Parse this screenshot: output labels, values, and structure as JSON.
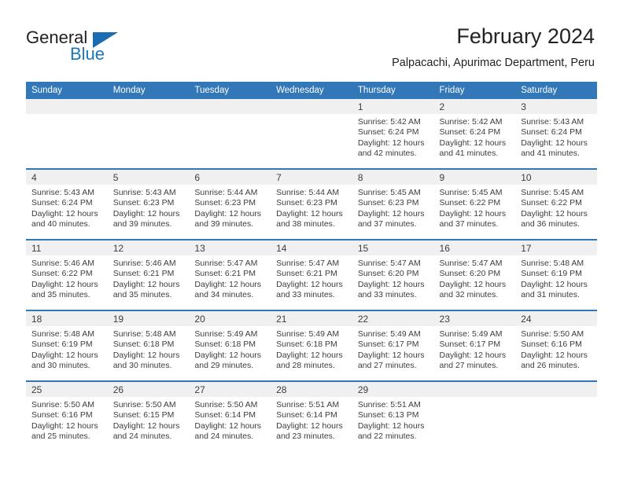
{
  "logo": {
    "word1": "General",
    "word2": "Blue",
    "accent_color": "#1b75bb",
    "triangle_color": "#1b6cb0"
  },
  "header": {
    "title": "February 2024",
    "subtitle": "Palpacachi, Apurimac Department, Peru"
  },
  "theme": {
    "header_blue": "#3277b8",
    "daynum_band": "#f0f0f0",
    "text": "#3d3d3d"
  },
  "calendar": {
    "weekday_headers": [
      "Sunday",
      "Monday",
      "Tuesday",
      "Wednesday",
      "Thursday",
      "Friday",
      "Saturday"
    ],
    "weeks": [
      [
        {
          "day": "",
          "lines": []
        },
        {
          "day": "",
          "lines": []
        },
        {
          "day": "",
          "lines": []
        },
        {
          "day": "",
          "lines": []
        },
        {
          "day": "1",
          "lines": [
            "Sunrise: 5:42 AM",
            "Sunset: 6:24 PM",
            "Daylight: 12 hours",
            "and 42 minutes."
          ]
        },
        {
          "day": "2",
          "lines": [
            "Sunrise: 5:42 AM",
            "Sunset: 6:24 PM",
            "Daylight: 12 hours",
            "and 41 minutes."
          ]
        },
        {
          "day": "3",
          "lines": [
            "Sunrise: 5:43 AM",
            "Sunset: 6:24 PM",
            "Daylight: 12 hours",
            "and 41 minutes."
          ]
        }
      ],
      [
        {
          "day": "4",
          "lines": [
            "Sunrise: 5:43 AM",
            "Sunset: 6:24 PM",
            "Daylight: 12 hours",
            "and 40 minutes."
          ]
        },
        {
          "day": "5",
          "lines": [
            "Sunrise: 5:43 AM",
            "Sunset: 6:23 PM",
            "Daylight: 12 hours",
            "and 39 minutes."
          ]
        },
        {
          "day": "6",
          "lines": [
            "Sunrise: 5:44 AM",
            "Sunset: 6:23 PM",
            "Daylight: 12 hours",
            "and 39 minutes."
          ]
        },
        {
          "day": "7",
          "lines": [
            "Sunrise: 5:44 AM",
            "Sunset: 6:23 PM",
            "Daylight: 12 hours",
            "and 38 minutes."
          ]
        },
        {
          "day": "8",
          "lines": [
            "Sunrise: 5:45 AM",
            "Sunset: 6:23 PM",
            "Daylight: 12 hours",
            "and 37 minutes."
          ]
        },
        {
          "day": "9",
          "lines": [
            "Sunrise: 5:45 AM",
            "Sunset: 6:22 PM",
            "Daylight: 12 hours",
            "and 37 minutes."
          ]
        },
        {
          "day": "10",
          "lines": [
            "Sunrise: 5:45 AM",
            "Sunset: 6:22 PM",
            "Daylight: 12 hours",
            "and 36 minutes."
          ]
        }
      ],
      [
        {
          "day": "11",
          "lines": [
            "Sunrise: 5:46 AM",
            "Sunset: 6:22 PM",
            "Daylight: 12 hours",
            "and 35 minutes."
          ]
        },
        {
          "day": "12",
          "lines": [
            "Sunrise: 5:46 AM",
            "Sunset: 6:21 PM",
            "Daylight: 12 hours",
            "and 35 minutes."
          ]
        },
        {
          "day": "13",
          "lines": [
            "Sunrise: 5:47 AM",
            "Sunset: 6:21 PM",
            "Daylight: 12 hours",
            "and 34 minutes."
          ]
        },
        {
          "day": "14",
          "lines": [
            "Sunrise: 5:47 AM",
            "Sunset: 6:21 PM",
            "Daylight: 12 hours",
            "and 33 minutes."
          ]
        },
        {
          "day": "15",
          "lines": [
            "Sunrise: 5:47 AM",
            "Sunset: 6:20 PM",
            "Daylight: 12 hours",
            "and 33 minutes."
          ]
        },
        {
          "day": "16",
          "lines": [
            "Sunrise: 5:47 AM",
            "Sunset: 6:20 PM",
            "Daylight: 12 hours",
            "and 32 minutes."
          ]
        },
        {
          "day": "17",
          "lines": [
            "Sunrise: 5:48 AM",
            "Sunset: 6:19 PM",
            "Daylight: 12 hours",
            "and 31 minutes."
          ]
        }
      ],
      [
        {
          "day": "18",
          "lines": [
            "Sunrise: 5:48 AM",
            "Sunset: 6:19 PM",
            "Daylight: 12 hours",
            "and 30 minutes."
          ]
        },
        {
          "day": "19",
          "lines": [
            "Sunrise: 5:48 AM",
            "Sunset: 6:18 PM",
            "Daylight: 12 hours",
            "and 30 minutes."
          ]
        },
        {
          "day": "20",
          "lines": [
            "Sunrise: 5:49 AM",
            "Sunset: 6:18 PM",
            "Daylight: 12 hours",
            "and 29 minutes."
          ]
        },
        {
          "day": "21",
          "lines": [
            "Sunrise: 5:49 AM",
            "Sunset: 6:18 PM",
            "Daylight: 12 hours",
            "and 28 minutes."
          ]
        },
        {
          "day": "22",
          "lines": [
            "Sunrise: 5:49 AM",
            "Sunset: 6:17 PM",
            "Daylight: 12 hours",
            "and 27 minutes."
          ]
        },
        {
          "day": "23",
          "lines": [
            "Sunrise: 5:49 AM",
            "Sunset: 6:17 PM",
            "Daylight: 12 hours",
            "and 27 minutes."
          ]
        },
        {
          "day": "24",
          "lines": [
            "Sunrise: 5:50 AM",
            "Sunset: 6:16 PM",
            "Daylight: 12 hours",
            "and 26 minutes."
          ]
        }
      ],
      [
        {
          "day": "25",
          "lines": [
            "Sunrise: 5:50 AM",
            "Sunset: 6:16 PM",
            "Daylight: 12 hours",
            "and 25 minutes."
          ]
        },
        {
          "day": "26",
          "lines": [
            "Sunrise: 5:50 AM",
            "Sunset: 6:15 PM",
            "Daylight: 12 hours",
            "and 24 minutes."
          ]
        },
        {
          "day": "27",
          "lines": [
            "Sunrise: 5:50 AM",
            "Sunset: 6:14 PM",
            "Daylight: 12 hours",
            "and 24 minutes."
          ]
        },
        {
          "day": "28",
          "lines": [
            "Sunrise: 5:51 AM",
            "Sunset: 6:14 PM",
            "Daylight: 12 hours",
            "and 23 minutes."
          ]
        },
        {
          "day": "29",
          "lines": [
            "Sunrise: 5:51 AM",
            "Sunset: 6:13 PM",
            "Daylight: 12 hours",
            "and 22 minutes."
          ]
        },
        {
          "day": "",
          "lines": []
        },
        {
          "day": "",
          "lines": []
        }
      ]
    ]
  }
}
